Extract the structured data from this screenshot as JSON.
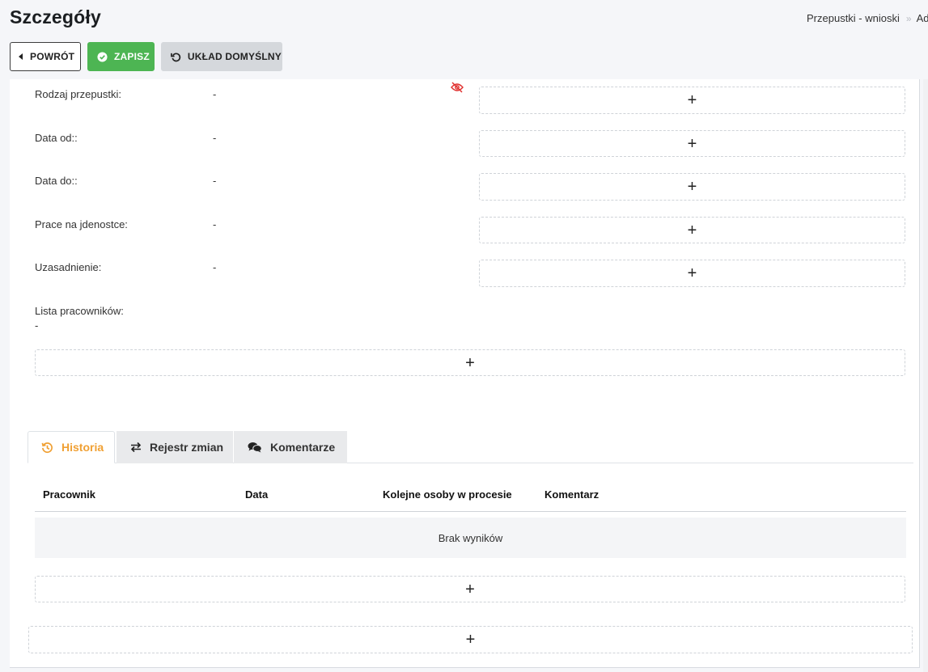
{
  "header": {
    "title": "Szczegóły",
    "breadcrumb": [
      "Przepustki - wnioski",
      "Ad"
    ]
  },
  "toolbar": {
    "back_label": "POWRÓT",
    "save_label": "ZAPISZ",
    "default_layout_label": "UKŁAD DOMYŚLNY"
  },
  "fields": [
    {
      "label": "Rodzaj przepustki:",
      "value": "-"
    },
    {
      "label": "Data od::",
      "value": "-"
    },
    {
      "label": "Data do::",
      "value": "-"
    },
    {
      "label": "Prace na jdenostce:",
      "value": "-"
    },
    {
      "label": "Uzasadnienie:",
      "value": "-"
    },
    {
      "label": "Lista pracowników:",
      "value": "-"
    }
  ],
  "add_symbol": "+",
  "tabs": [
    {
      "label": "Historia",
      "icon": "history-icon",
      "active": true
    },
    {
      "label": "Rejestr zmian",
      "icon": "swap-arrows-icon",
      "active": false
    },
    {
      "label": "Komentarze",
      "icon": "comments-icon",
      "active": false
    }
  ],
  "history_table": {
    "columns": [
      "Pracownik",
      "Data",
      "Kolejne osoby w procesie",
      "Komentarz"
    ],
    "empty_text": "Brak wyników"
  },
  "colors": {
    "save": "#4db553",
    "active_tab": "#f0a033",
    "hidden_icon": "#e0312f"
  }
}
